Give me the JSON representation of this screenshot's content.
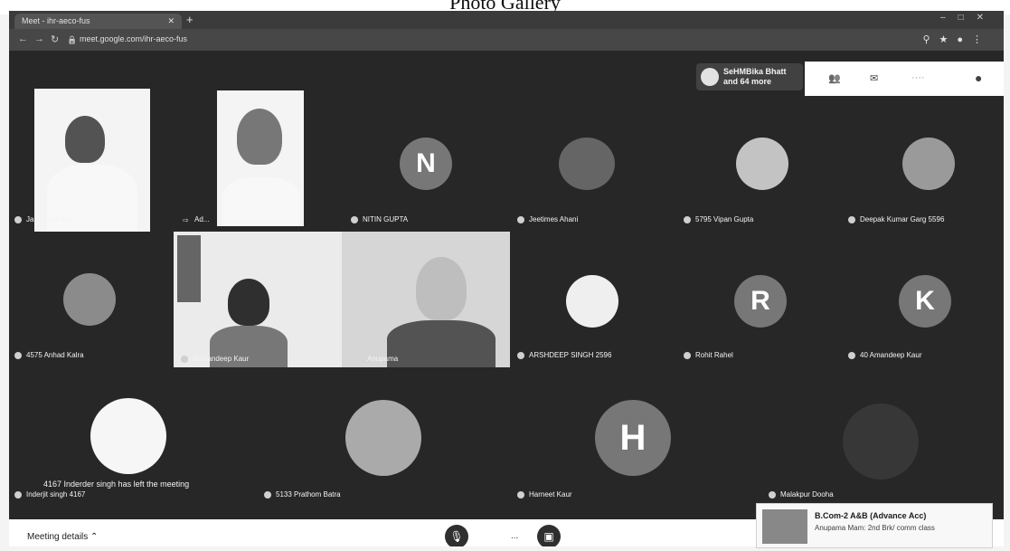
{
  "page_header": "Photo Gallery",
  "browser": {
    "tab_title": "Meet - ihr-aeco-fus",
    "url": "meet.google.com/ihr-aeco-fus"
  },
  "notification": {
    "text_line1": "SeHMBika Bhatt",
    "text_line2": "and 64 more"
  },
  "participants": [
    {
      "name": "Jaspreet Kaur"
    },
    {
      "name": "Ad..."
    },
    {
      "name": "NITIN GUPTA",
      "initial": "N"
    },
    {
      "name": "Jeetimes Ahani"
    },
    {
      "name": "5795 Vipan Gupta"
    },
    {
      "name": "Deepak Kumar Garg 5596"
    },
    {
      "name": "4575 Anhad Kalra"
    },
    {
      "name": "Kumandeep Kaur"
    },
    {
      "name": "Anupama"
    },
    {
      "name": "ARSHDEEP SINGH 2596"
    },
    {
      "name": "Rohit Rahel",
      "initial": "R"
    },
    {
      "name": "40 Amandeep Kaur",
      "initial": "K"
    },
    {
      "name": "5133 Prathom Batra"
    },
    {
      "name": "Harneet Kaur",
      "initial": "H"
    },
    {
      "name": "Malakpur Dooha"
    }
  ],
  "left_message": "4167 Inderder singh has left the meeting",
  "bottom_left_name": "Inderjit singh 4167",
  "bottom_bar": {
    "meeting_details": "Meeting details",
    "more": "..."
  },
  "popup": {
    "title": "B.Com-2 A&B (Advance Acc)",
    "subtitle": "Anupama Mam: 2nd Brk/ comm class"
  }
}
